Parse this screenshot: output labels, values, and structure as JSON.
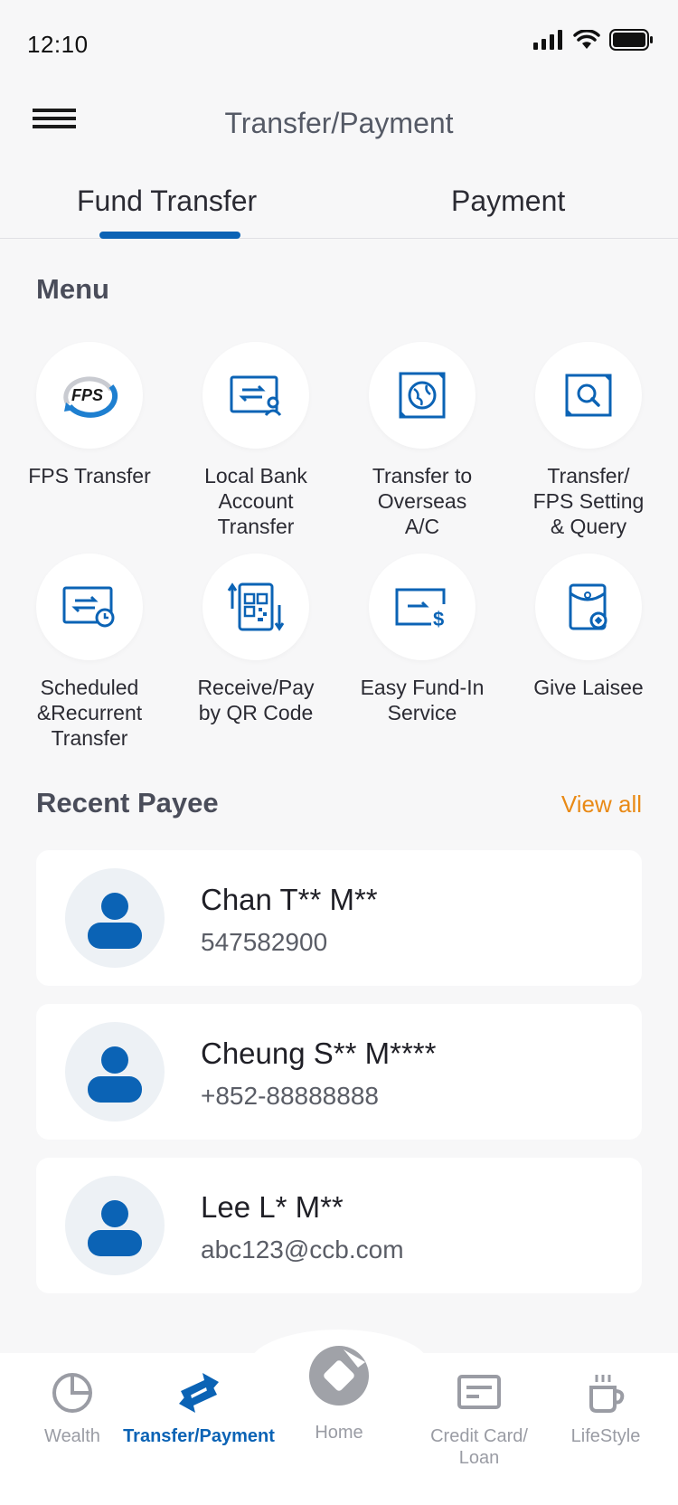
{
  "status_bar": {
    "time": "12:10"
  },
  "header": {
    "title": "Transfer/Payment"
  },
  "tabs": [
    {
      "label": "Fund Transfer"
    },
    {
      "label": "Payment"
    }
  ],
  "menu": {
    "title": "Menu",
    "items": [
      {
        "label": "FPS Transfer",
        "icon": "fps-icon"
      },
      {
        "label": "Local Bank\nAccount\nTransfer",
        "icon": "local-bank-transfer-icon"
      },
      {
        "label": "Transfer to\nOverseas\nA/C",
        "icon": "overseas-transfer-icon"
      },
      {
        "label": "Transfer/\nFPS Setting\n& Query",
        "icon": "query-icon"
      },
      {
        "label": "Scheduled\n&Recurrent\nTransfer",
        "icon": "scheduled-transfer-icon"
      },
      {
        "label": "Receive/Pay\nby QR Code",
        "icon": "qr-code-icon"
      },
      {
        "label": "Easy Fund-In\nService",
        "icon": "fund-in-icon"
      },
      {
        "label": "Give Laisee",
        "icon": "laisee-icon"
      }
    ]
  },
  "recent_payee": {
    "title": "Recent Payee",
    "view_all": "View all",
    "payees": [
      {
        "name": "Chan T** M**",
        "detail": "547582900"
      },
      {
        "name": "Cheung S** M****",
        "detail": "+852-88888888"
      },
      {
        "name": "Lee L* M**",
        "detail": "abc123@ccb.com"
      }
    ]
  },
  "bottom_nav": [
    {
      "label": "Wealth",
      "icon": "pie-chart-icon",
      "active": false
    },
    {
      "label": "Transfer/Payment",
      "icon": "transfer-arrows-icon",
      "active": true
    },
    {
      "label": "Home",
      "icon": "home-logo-icon",
      "active": false
    },
    {
      "label": "Credit Card/\nLoan",
      "icon": "credit-card-icon",
      "active": false
    },
    {
      "label": "LifeStyle",
      "icon": "coffee-cup-icon",
      "active": false
    }
  ],
  "colors": {
    "accent": "#0b63b5",
    "link": "#e98a16",
    "background": "#f7f7f8"
  }
}
